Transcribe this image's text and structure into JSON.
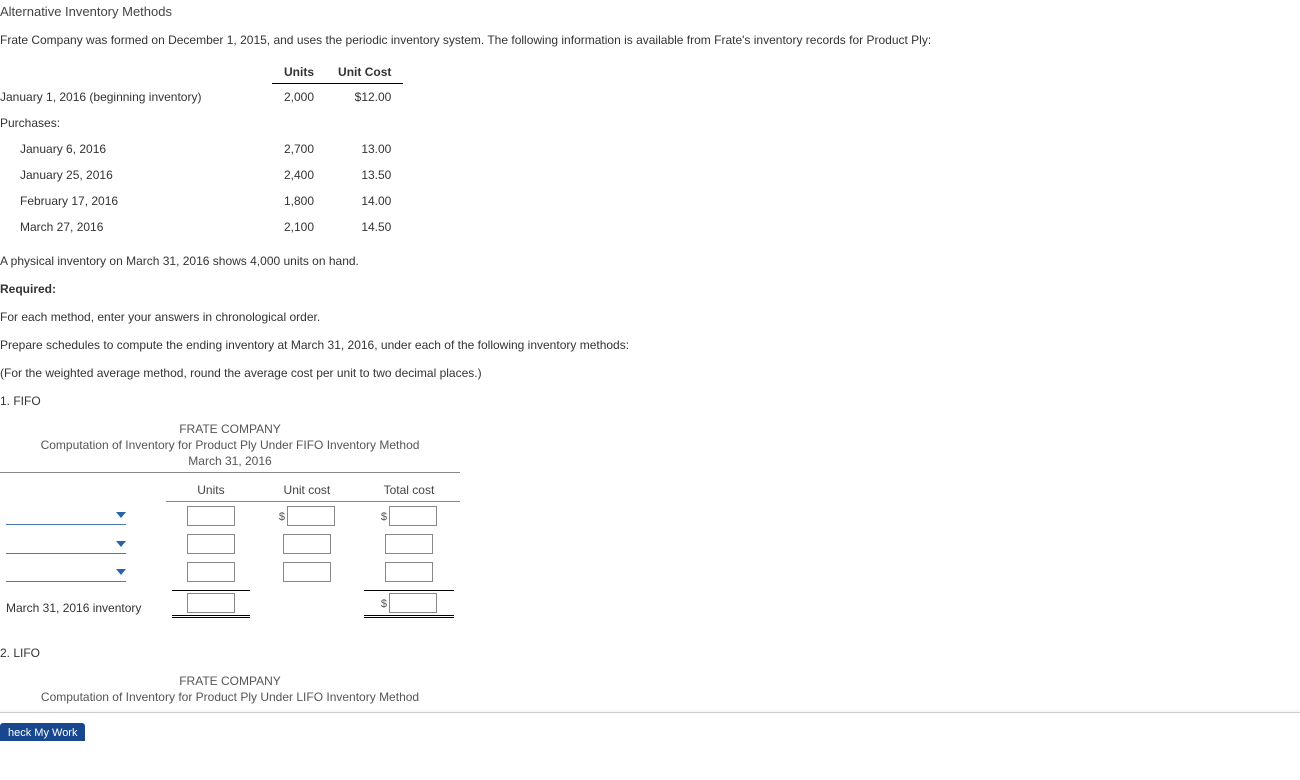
{
  "title": "Alternative Inventory Methods",
  "intro": "Frate Company was formed on December 1, 2015, and uses the periodic inventory system. The following information is available from Frate's inventory records for Product Ply:",
  "data_table": {
    "headers": {
      "units": "Units",
      "unit_cost": "Unit Cost"
    },
    "rows": [
      {
        "label": "January 1, 2016 (beginning inventory)",
        "indent": false,
        "units": "2,000",
        "unit_cost": "$12.00"
      },
      {
        "label": "Purchases:",
        "indent": false,
        "units": "",
        "unit_cost": ""
      },
      {
        "label": "January 6, 2016",
        "indent": true,
        "units": "2,700",
        "unit_cost": "13.00"
      },
      {
        "label": "January 25, 2016",
        "indent": true,
        "units": "2,400",
        "unit_cost": "13.50"
      },
      {
        "label": "February 17, 2016",
        "indent": true,
        "units": "1,800",
        "unit_cost": "14.00"
      },
      {
        "label": "March 27, 2016",
        "indent": true,
        "units": "2,100",
        "unit_cost": "14.50"
      }
    ]
  },
  "phys": "A physical inventory on March 31, 2016 shows 4,000 units on hand.",
  "required_label": "Required:",
  "instr1": "For each method, enter your answers in chronological order.",
  "instr2": "Prepare schedules to compute the ending inventory at March 31, 2016, under each of the following inventory methods:",
  "instr3": "(For the weighted average method, round the average cost per unit to two decimal places.)",
  "q1": {
    "num": "1. FIFO"
  },
  "q2": {
    "num": "2. LIFO"
  },
  "sched": {
    "company": "FRATE COMPANY",
    "fifo_title": "Computation of Inventory for Product Ply Under FIFO Inventory Method",
    "lifo_title": "Computation of Inventory for Product Ply Under LIFO Inventory Method",
    "date": "March 31, 2016",
    "cols": {
      "units": "Units",
      "unit_cost": "Unit cost",
      "total": "Total cost"
    },
    "total_row": "March 31, 2016 inventory"
  },
  "footer_btn": "heck My Work"
}
